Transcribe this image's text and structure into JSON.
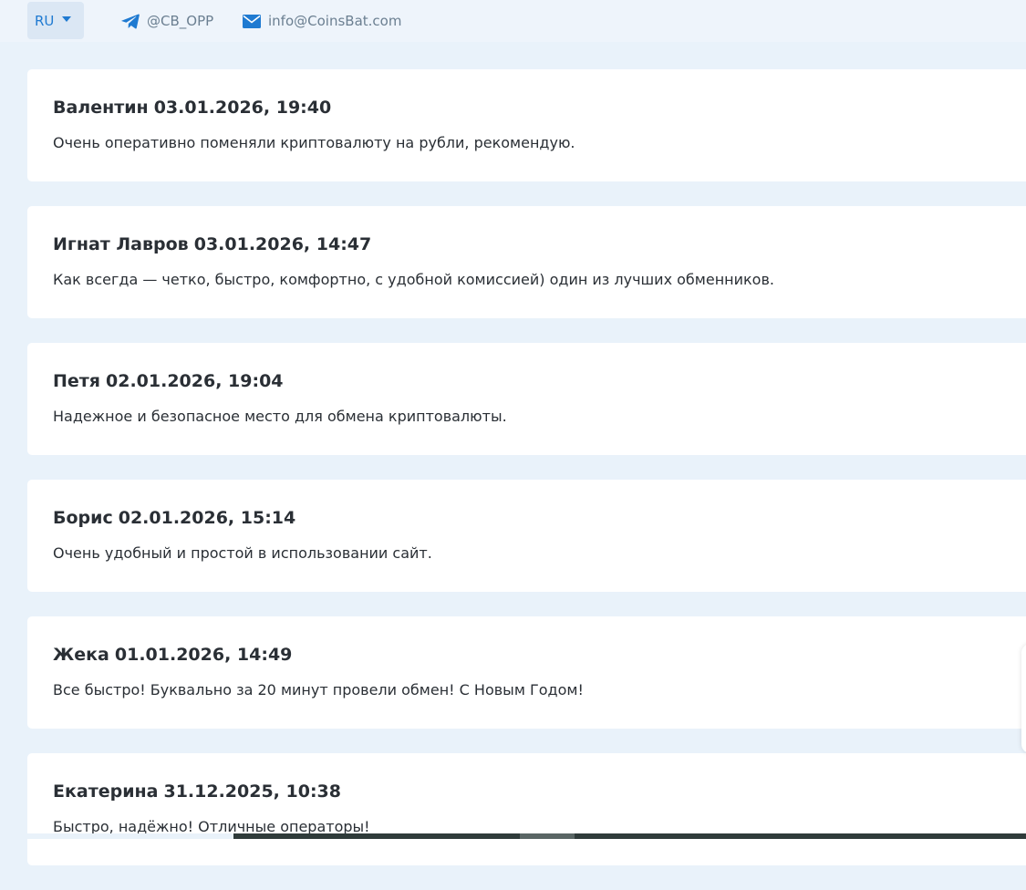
{
  "header": {
    "language": "RU",
    "telegram": "@CB_OPP",
    "email": "info@CoinsBat.com",
    "accent_color": "#1f7ad1"
  },
  "reviews": [
    {
      "author": "Валентин",
      "datetime": "03.01.2026, 19:40",
      "text": "Очень оперативно поменяли криптовалюту на рубли, рекомендую."
    },
    {
      "author": "Игнат Лавров",
      "datetime": "03.01.2026, 14:47",
      "text": "Как всегда — четко, быстро, комфортно, с удобной комиссией) один из лучших обменников."
    },
    {
      "author": "Петя",
      "datetime": "02.01.2026, 19:04",
      "text": "Надежное и безопасное место для обмена криптовалюты."
    },
    {
      "author": "Борис",
      "datetime": "02.01.2026, 15:14",
      "text": "Очень удобный и простой в использовании сайт."
    },
    {
      "author": "Жека",
      "datetime": "01.01.2026, 14:49",
      "text": "Все быстро! Буквально за 20 минут провели обмен! С Новым Годом!"
    },
    {
      "author": "Екатерина",
      "datetime": "31.12.2025, 10:38",
      "text": "Быстро, надёжно! Отличные операторы!"
    }
  ]
}
